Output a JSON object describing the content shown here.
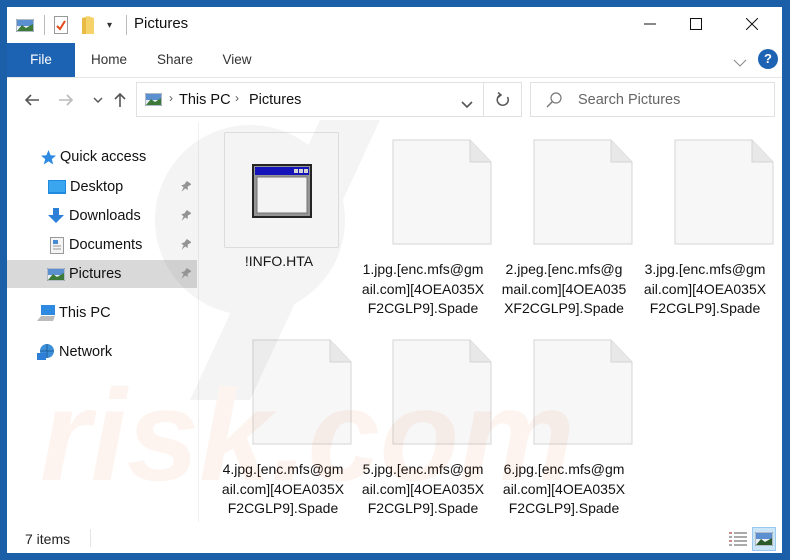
{
  "window": {
    "title": "Pictures",
    "controls": {
      "minimize": "—",
      "maximize": "☐",
      "close": "✕"
    }
  },
  "quick_access_toolbar": {
    "icons": [
      "pictures-app-icon",
      "properties-icon",
      "new-folder-icon",
      "customize-dropdown-icon"
    ]
  },
  "ribbon": {
    "tabs": [
      {
        "label": "File",
        "active": true
      },
      {
        "label": "Home"
      },
      {
        "label": "Share"
      },
      {
        "label": "View"
      }
    ],
    "expand_icon": "chevron-down-icon",
    "help_label": "?"
  },
  "nav": {
    "back": "←",
    "forward": "→",
    "recent": "⌄",
    "up": "↑",
    "breadcrumb": [
      "This PC",
      "Pictures"
    ],
    "refresh": "↻",
    "search_placeholder": "Search Pictures"
  },
  "sidebar": {
    "items": [
      {
        "label": "Quick access",
        "icon": "star-icon",
        "pinned": false
      },
      {
        "label": "Desktop",
        "icon": "desktop-icon",
        "pinned": true
      },
      {
        "label": "Downloads",
        "icon": "download-icon",
        "pinned": true
      },
      {
        "label": "Documents",
        "icon": "documents-icon",
        "pinned": true
      },
      {
        "label": "Pictures",
        "icon": "pictures-icon",
        "pinned": true,
        "selected": true
      },
      {
        "label": "This PC",
        "icon": "computer-icon",
        "pinned": false
      },
      {
        "label": "Network",
        "icon": "network-icon",
        "pinned": false
      }
    ]
  },
  "files": [
    {
      "name": "!INFO.HTA",
      "type": "hta"
    },
    {
      "name": "1.jpg.[enc.mfs@gmail.com][4OEA035XF2CGLP9].Spade",
      "type": "blank"
    },
    {
      "name": "2.jpeg.[enc.mfs@gmail.com][4OEA035XF2CGLP9].Spade",
      "type": "blank"
    },
    {
      "name": "3.jpg.[enc.mfs@gmail.com][4OEA035XF2CGLP9].Spade",
      "type": "blank"
    },
    {
      "name": "4.jpg.[enc.mfs@gmail.com][4OEA035XF2CGLP9].Spade",
      "type": "blank"
    },
    {
      "name": "5.jpg.[enc.mfs@gmail.com][4OEA035XF2CGLP9].Spade",
      "type": "blank"
    },
    {
      "name": "6.jpg.[enc.mfs@gmail.com][4OEA035XF2CGLP9].Spade",
      "type": "blank"
    }
  ],
  "status": {
    "item_count": "7 items",
    "view_modes": [
      {
        "name": "details-view",
        "active": false
      },
      {
        "name": "large-icons-view",
        "active": true
      }
    ]
  },
  "colors": {
    "frame": "#1a5fa8",
    "file_tab": "#1c63b4",
    "selected_item": "#d9d9d9",
    "help": "#1c63b4"
  }
}
